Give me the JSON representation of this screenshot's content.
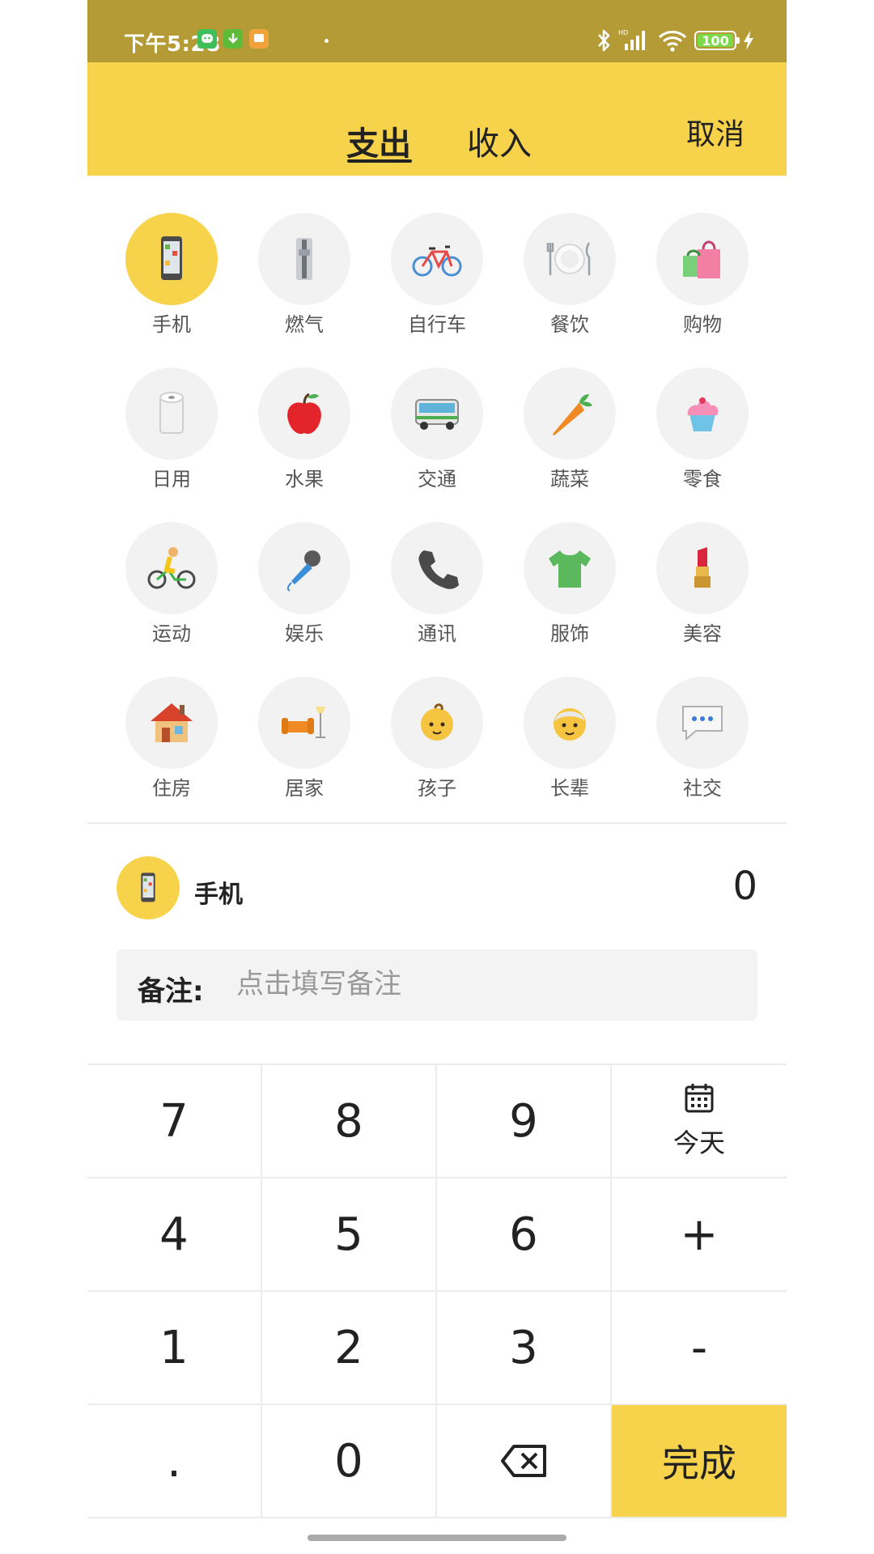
{
  "status_bar": {
    "time": "下午5:28",
    "battery": "100"
  },
  "header": {
    "tabs": [
      "支出",
      "收入"
    ],
    "active_tab": "支出",
    "cancel_label": "取消"
  },
  "categories": [
    {
      "label": "手机",
      "icon": "phone-icon",
      "selected": true
    },
    {
      "label": "燃气",
      "icon": "gas-meter-icon"
    },
    {
      "label": "自行车",
      "icon": "bicycle-icon"
    },
    {
      "label": "餐饮",
      "icon": "plate-icon"
    },
    {
      "label": "购物",
      "icon": "shopping-bag-icon"
    },
    {
      "label": "日用",
      "icon": "toilet-paper-icon"
    },
    {
      "label": "水果",
      "icon": "apple-icon"
    },
    {
      "label": "交通",
      "icon": "bus-icon"
    },
    {
      "label": "蔬菜",
      "icon": "carrot-icon"
    },
    {
      "label": "零食",
      "icon": "cupcake-icon"
    },
    {
      "label": "运动",
      "icon": "cyclist-icon"
    },
    {
      "label": "娱乐",
      "icon": "microphone-icon"
    },
    {
      "label": "通讯",
      "icon": "telephone-icon"
    },
    {
      "label": "服饰",
      "icon": "tshirt-icon"
    },
    {
      "label": "美容",
      "icon": "lipstick-icon"
    },
    {
      "label": "住房",
      "icon": "house-icon"
    },
    {
      "label": "居家",
      "icon": "sofa-icon"
    },
    {
      "label": "孩子",
      "icon": "baby-icon"
    },
    {
      "label": "长辈",
      "icon": "elder-icon"
    },
    {
      "label": "社交",
      "icon": "speech-bubble-icon"
    }
  ],
  "selected": {
    "name": "手机",
    "amount": "0"
  },
  "note": {
    "label": "备注:",
    "placeholder": "点击填写备注",
    "value": ""
  },
  "keypad": {
    "keys": [
      "7",
      "8",
      "9",
      "今天",
      "4",
      "5",
      "6",
      "+",
      "1",
      "2",
      "3",
      "-",
      ".",
      "0",
      "",
      "完成"
    ]
  },
  "colors": {
    "accent": "#f7d24b",
    "status_bar": "#b59b36"
  }
}
